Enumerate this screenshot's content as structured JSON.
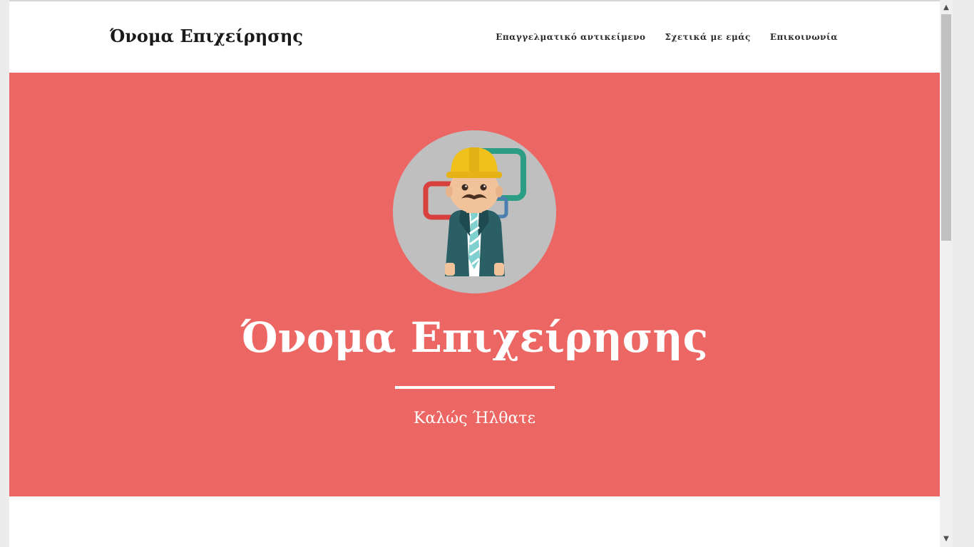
{
  "navbar": {
    "brand": "Όνομα Επιχείρησης",
    "links": [
      {
        "label": "Επαγγελματικό αντικείμενο"
      },
      {
        "label": "Σχετικά με εμάς"
      },
      {
        "label": "Επικοινωνία"
      }
    ]
  },
  "hero": {
    "title": "Όνομα Επιχείρησης",
    "subtitle": "Καλώς Ήλθατε",
    "background_color": "#ec6764",
    "avatar_icon": "engineer-avatar-icon"
  },
  "scrollbar": {
    "up_icon": "▲",
    "down_icon": "▼"
  }
}
